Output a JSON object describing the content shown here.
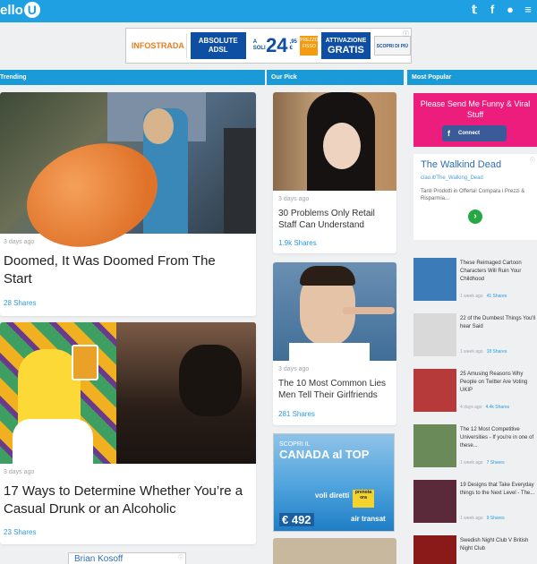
{
  "header": {
    "logo_text": "ello",
    "logo_mark": "U",
    "icons": [
      "twitter-icon",
      "facebook-icon",
      "user-icon",
      "menu-icon"
    ]
  },
  "ad_banner": {
    "brand": "INFOSTRADA",
    "product": "ABSOLUTE ADSL",
    "price_prefix": "A SOLI",
    "price": "24",
    "price_cents": ",95 €",
    "price_unit": "AL MESE",
    "badge": "PREZZO FISSO",
    "activation_label": "ATTIVAZIONE",
    "activation_value": "GRATIS",
    "cta": "SCOPRI DI PIÙ"
  },
  "columns": {
    "trending": "Trending",
    "our_pick": "Our Pick",
    "most_popular": "Most Popular"
  },
  "trending": [
    {
      "ago": "3 days ago",
      "title": "Doomed, It Was Doomed From The Start",
      "shares": "28 Shares"
    },
    {
      "ago": "3 days ago",
      "title": "17 Ways to Determine Whether You’re a Casual Drunk or an Alcoholic",
      "shares": "23 Shares"
    }
  ],
  "our_pick": [
    {
      "ago": "3 days ago",
      "title": "30 Problems Only Retail Staff Can Understand",
      "shares": "1.9k Shares"
    },
    {
      "ago": "3 days ago",
      "title": "The 10 Most Common Lies Men Tell Their Girlfriends",
      "shares": "281 Shares"
    }
  ],
  "travel_ad": {
    "small": "SCOPRI IL",
    "headline": "CANADA al TOP",
    "offer": "voli diretti",
    "badge": "prenota ora",
    "price_prefix": "a partire da",
    "price": "€ 492",
    "airline": "air transat"
  },
  "connect_box": {
    "message": "Please Send Me Funny & Viral Stuff",
    "button": "Connect"
  },
  "walkind_ad": {
    "title": "The Walkind Dead",
    "url": "ciao.it/The_Walking_Dead",
    "desc": "Tanti Prodotti in Offerta! Compara i Prezzi & Risparmia..."
  },
  "most_popular": [
    {
      "title": "These Reimaged Cartoon Characters Will Ruin Your Childhood",
      "ago": "1 week ago",
      "shares": "41 Shares",
      "color": "#3a7bb8"
    },
    {
      "title": "22 of the Dumbest Things You'll hear Said",
      "ago": "1 week ago",
      "shares": "18 Shares",
      "color": "#d9d9d9"
    },
    {
      "title": "25 Amusing Reasons Why People on Twitter Are Voting UKIP",
      "ago": "4 days ago",
      "shares": "4.4k Shares",
      "color": "#b73a3a"
    },
    {
      "title": "The 12 Most Competitive Universities - If you're in one of these...",
      "ago": "1 week ago",
      "shares": "7 Shares",
      "color": "#6a8a5a"
    },
    {
      "title": "19 Designs that Take Everyday things to the Next Level - The...",
      "ago": "1 week ago",
      "shares": "9 Shares",
      "color": "#5a2a3a"
    },
    {
      "title": "Swedish Night Club V British Night Club",
      "ago": "",
      "shares": "",
      "color": "#8a1a1a"
    }
  ],
  "bottom_ad": {
    "text": "Brian Kosoff"
  }
}
